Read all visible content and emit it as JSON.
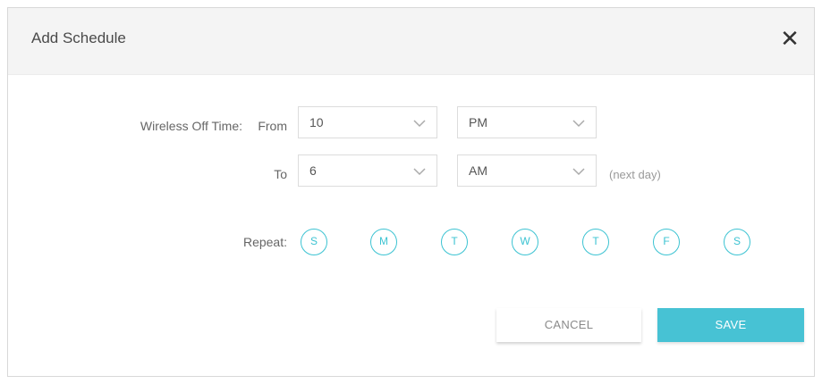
{
  "dialog": {
    "title": "Add Schedule",
    "close_symbol": "✕"
  },
  "schedule": {
    "wireless_off_label": "Wireless Off Time:",
    "from_label": "From",
    "to_label": "To",
    "from_hour": "10",
    "from_period": "PM",
    "to_hour": "6",
    "to_period": "AM",
    "next_day_hint": "(next day)"
  },
  "repeat": {
    "label": "Repeat:",
    "days": [
      "S",
      "M",
      "T",
      "W",
      "T",
      "F",
      "S"
    ]
  },
  "buttons": {
    "cancel_label": "CANCEL",
    "save_label": "SAVE"
  },
  "colors": {
    "accent": "#47c2d4",
    "day_circle": "#3cc3d2"
  }
}
